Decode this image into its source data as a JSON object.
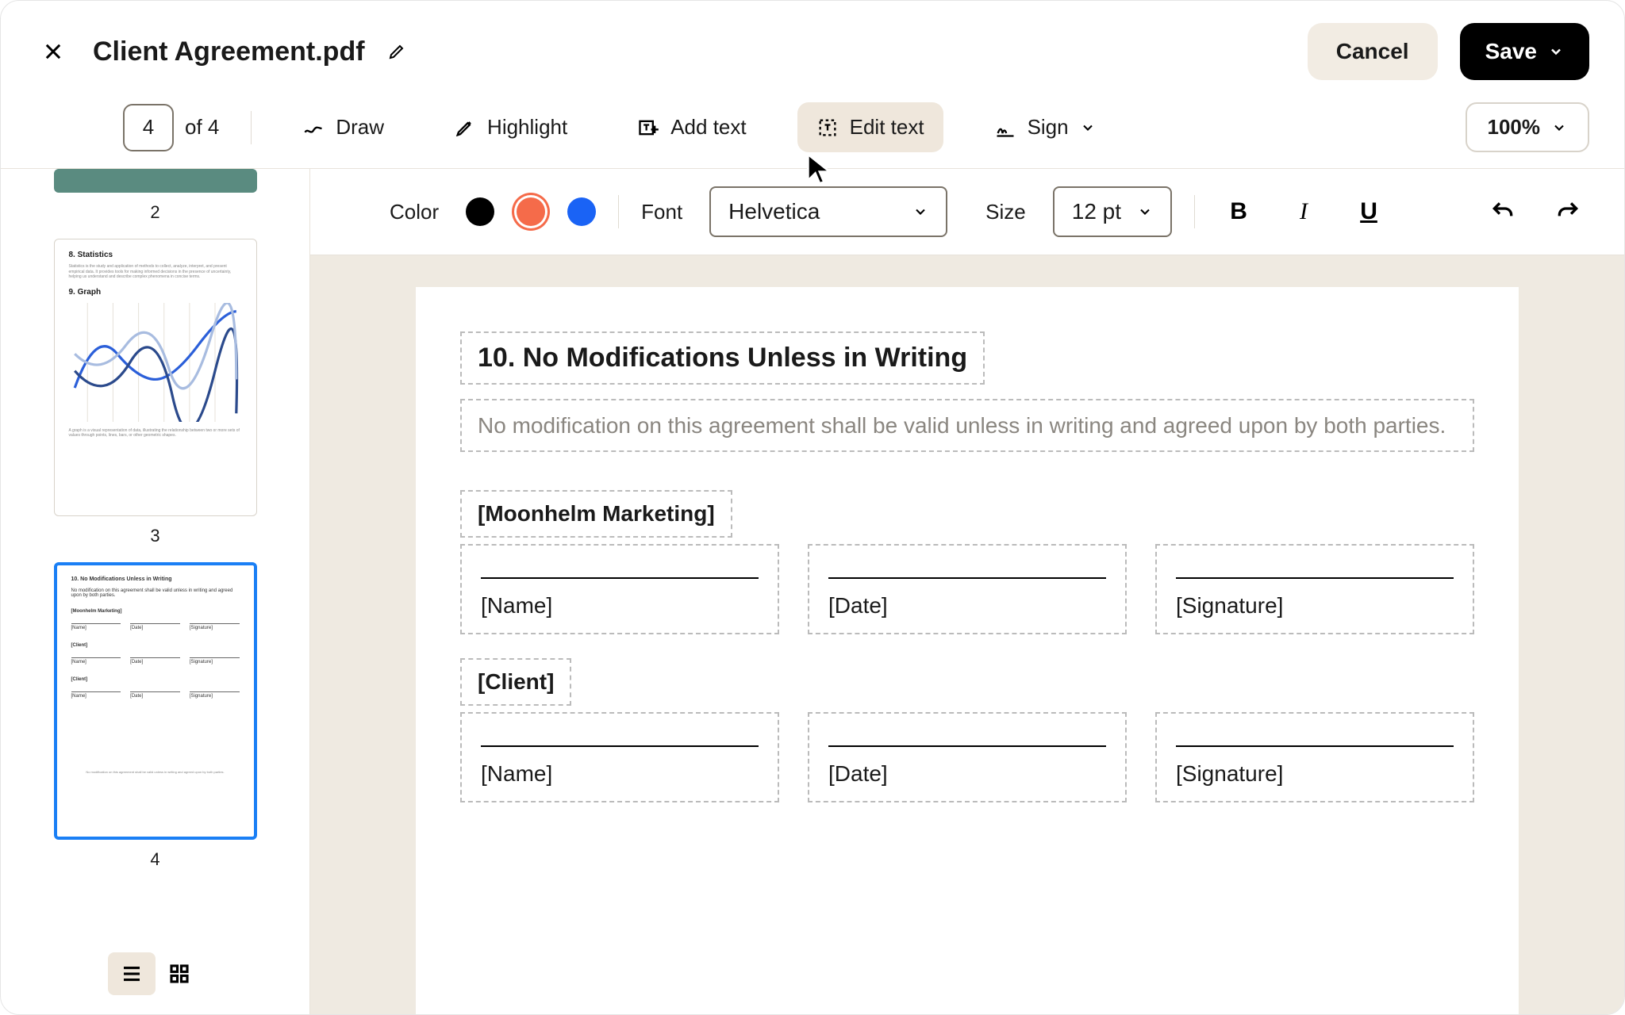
{
  "header": {
    "doc_title": "Client Agreement.pdf",
    "cancel_label": "Cancel",
    "save_label": "Save"
  },
  "toolbar": {
    "page_current": "4",
    "page_total": "of 4",
    "draw_label": "Draw",
    "highlight_label": "Highlight",
    "addtext_label": "Add text",
    "edittext_label": "Edit text",
    "sign_label": "Sign",
    "zoom_label": "100%"
  },
  "format": {
    "color_label": "Color",
    "font_label": "Font",
    "font_value": "Helvetica",
    "size_label": "Size",
    "size_value": "12 pt",
    "bold": "B",
    "italic": "I",
    "underline": "U"
  },
  "thumbnails": {
    "n2": "2",
    "n3": "3",
    "n4": "4",
    "p3_title_a": "8. Statistics",
    "p3_body_a": "Statistics is the study and application of methods to collect, analyze, interpret, and present empirical data. It provides tools for making informed decisions in the presence of uncertainty, helping us understand and describe complex phenomena in concise terms.",
    "p3_title_b": "9. Graph",
    "p3_body_b": "A graph is a visual representation of data, illustrating the relationship between two or more sets of values through points, lines, bars, or other geometric shapes.",
    "p4_title": "10. No Modifications Unless in Writing",
    "p4_body": "No modification on this agreement shall be valid unless in writing and agreed upon by both parties.",
    "p4_party1": "[Moonhelm Marketing]",
    "p4_party2": "[Client]",
    "p4_name": "[Name]",
    "p4_date": "[Date]",
    "p4_sig": "[Signature]",
    "p4_footer": "No modification on this agreement shall be valid unless in writing and agreed upon by both parties."
  },
  "document": {
    "heading": "10. No Modifications Unless in Writing",
    "body": "No modification on this agreement shall be valid unless in writing and agreed upon by both parties.",
    "party1": "[Moonhelm Marketing]",
    "party2": "[Client]",
    "field_name": "[Name]",
    "field_date": "[Date]",
    "field_signature": "[Signature]"
  }
}
